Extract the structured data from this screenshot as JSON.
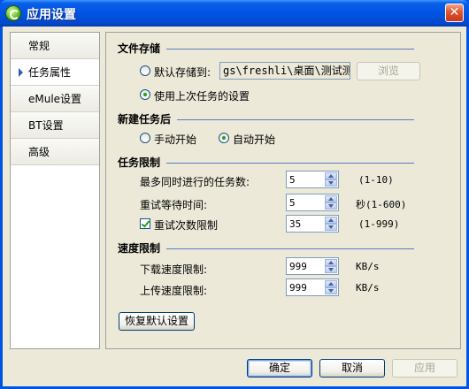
{
  "window": {
    "title": "应用设置"
  },
  "nav": {
    "items": [
      {
        "label": "常规"
      },
      {
        "label": "任务属性"
      },
      {
        "label": "eMule设置"
      },
      {
        "label": "BT设置"
      },
      {
        "label": "高级"
      }
    ],
    "active": "任务属性"
  },
  "file_storage": {
    "title": "文件存储",
    "default_path_label": "默认存储到:",
    "default_path_value": "gs\\freshli\\桌面\\测试测试",
    "browse_label": "浏览",
    "use_last_label": "使用上次任务的设置",
    "selected": "use_last"
  },
  "new_task": {
    "title": "新建任务后",
    "manual_label": "手动开始",
    "auto_label": "自动开始",
    "selected": "auto"
  },
  "task_limit": {
    "title": "任务限制",
    "max_concurrent_label": "最多同时进行的任务数:",
    "max_concurrent_value": "5",
    "max_concurrent_range": "(1-10)",
    "retry_wait_label": "重试等待时间:",
    "retry_wait_value": "5",
    "retry_wait_unit": "秒(1-600)",
    "retry_limit_label": "重试次数限制",
    "retry_limit_checked": true,
    "retry_limit_value": "35",
    "retry_limit_range": "(1-999)"
  },
  "speed_limit": {
    "title": "速度限制",
    "download_label": "下载速度限制:",
    "download_value": "999",
    "download_unit": "KB/s",
    "upload_label": "上传速度限制:",
    "upload_value": "999",
    "upload_unit": "KB/s"
  },
  "restore_label": "恢复默认设置",
  "footer": {
    "ok_label": "确定",
    "cancel_label": "取消",
    "apply_label": "应用"
  }
}
